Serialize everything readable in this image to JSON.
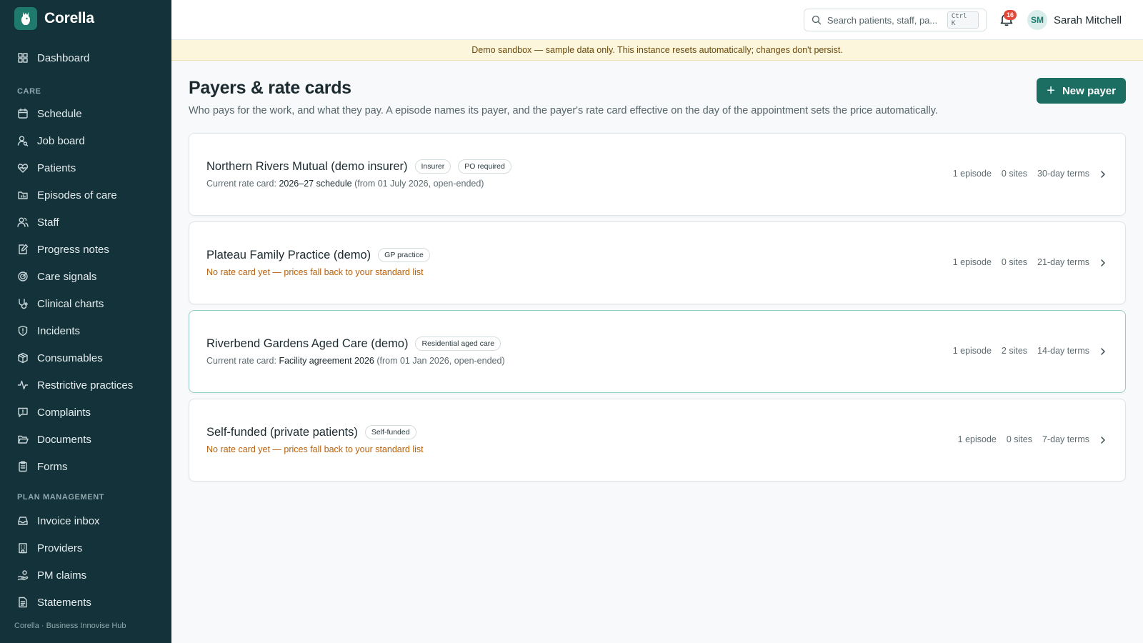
{
  "app": {
    "name": "Corella",
    "footer": "Corella · Business Innovise Hub"
  },
  "sidebar": {
    "top": [
      {
        "label": "Dashboard",
        "icon": "grid-icon"
      }
    ],
    "care_label": "CARE",
    "care": [
      {
        "label": "Schedule",
        "icon": "calendar-icon"
      },
      {
        "label": "Job board",
        "icon": "user-search-icon"
      },
      {
        "label": "Patients",
        "icon": "heart-icon"
      },
      {
        "label": "Episodes of care",
        "icon": "folder-chart-icon"
      },
      {
        "label": "Staff",
        "icon": "users-icon"
      },
      {
        "label": "Progress notes",
        "icon": "note-edit-icon"
      },
      {
        "label": "Care signals",
        "icon": "target-icon"
      },
      {
        "label": "Clinical charts",
        "icon": "stethoscope-icon"
      },
      {
        "label": "Incidents",
        "icon": "shield-alert-icon"
      },
      {
        "label": "Consumables",
        "icon": "package-icon"
      },
      {
        "label": "Restrictive practices",
        "icon": "activity-icon"
      },
      {
        "label": "Complaints",
        "icon": "message-alert-icon"
      },
      {
        "label": "Documents",
        "icon": "folder-open-icon"
      },
      {
        "label": "Forms",
        "icon": "clipboard-icon"
      }
    ],
    "pm_label": "PLAN MANAGEMENT",
    "pm": [
      {
        "label": "Invoice inbox",
        "icon": "inbox-icon"
      },
      {
        "label": "Providers",
        "icon": "building-icon"
      },
      {
        "label": "PM claims",
        "icon": "hand-coins-icon"
      },
      {
        "label": "Statements",
        "icon": "file-text-icon"
      }
    ]
  },
  "topbar": {
    "search_placeholder": "Search patients, staff, pa...",
    "search_shortcut": "Ctrl K",
    "notifications_count": "16",
    "user_initials": "SM",
    "user_name": "Sarah Mitchell"
  },
  "banner": "Demo sandbox — sample data only. This instance resets automatically; changes don't persist.",
  "page": {
    "title": "Payers & rate cards",
    "description": "Who pays for the work, and what they pay. A episode names its payer, and the payer's rate card effective on the day of the appointment sets the price automatically.",
    "new_button": "New payer"
  },
  "payers": [
    {
      "name": "Northern Rivers Mutual (demo insurer)",
      "badges": [
        "Insurer",
        "PO required"
      ],
      "has_rate_card": true,
      "rate_prefix": "Current rate card: ",
      "rate_name": "2026–27 schedule",
      "rate_range": " (from 01 July 2026, open-ended)",
      "episodes": "1 episode",
      "sites": "0 sites",
      "terms": "30-day terms"
    },
    {
      "name": "Plateau Family Practice (demo)",
      "badges": [
        "GP practice"
      ],
      "has_rate_card": false,
      "no_rate_text": "No rate card yet — prices fall back to your standard list",
      "episodes": "1 episode",
      "sites": "0 sites",
      "terms": "21-day terms"
    },
    {
      "name": "Riverbend Gardens Aged Care (demo)",
      "badges": [
        "Residential aged care"
      ],
      "has_rate_card": true,
      "highlight": true,
      "rate_prefix": "Current rate card: ",
      "rate_name": "Facility agreement 2026",
      "rate_range": " (from 01 Jan 2026, open-ended)",
      "episodes": "1 episode",
      "sites": "2 sites",
      "terms": "14-day terms"
    },
    {
      "name": "Self-funded (private patients)",
      "badges": [
        "Self-funded"
      ],
      "has_rate_card": false,
      "no_rate_text": "No rate card yet — prices fall back to your standard list",
      "episodes": "1 episode",
      "sites": "0 sites",
      "terms": "7-day terms"
    }
  ],
  "colors": {
    "sidebar": "#143239",
    "accent": "#1c6d62",
    "warning_text": "#b8610f",
    "banner_bg": "#fcf6dc",
    "badge_red": "#e0493c"
  }
}
